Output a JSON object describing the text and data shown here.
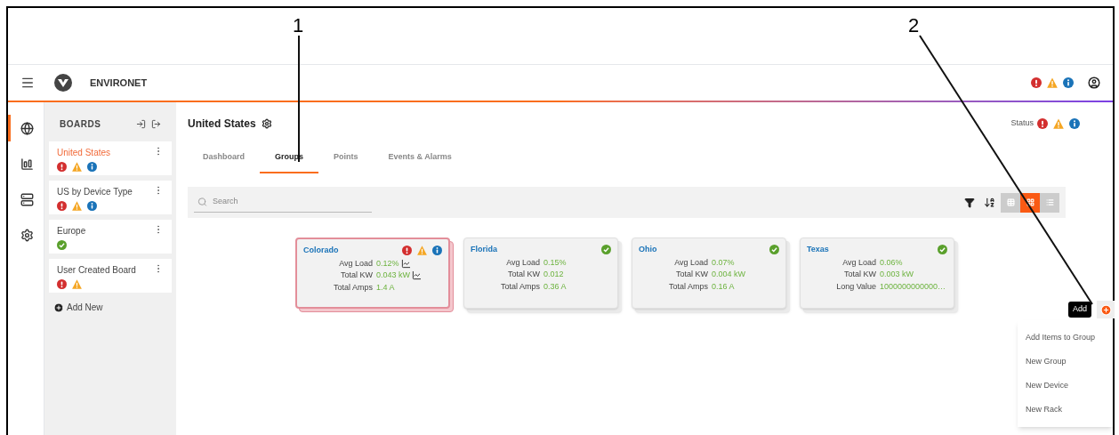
{
  "callouts": [
    {
      "number": "1"
    },
    {
      "number": "2"
    }
  ],
  "header": {
    "app_name": "ENVIRONET",
    "statuses": [
      {
        "kind": "critical"
      },
      {
        "kind": "warning"
      },
      {
        "kind": "info"
      }
    ]
  },
  "rail": [
    {
      "kind": "globe",
      "selected": true
    },
    {
      "kind": "chart",
      "selected": false
    },
    {
      "kind": "device",
      "selected": false
    },
    {
      "kind": "settings",
      "selected": false
    }
  ],
  "boards": {
    "title": "BOARDS",
    "items": [
      {
        "name": "United States",
        "selected": true,
        "statuses": [
          {
            "kind": "critical"
          },
          {
            "kind": "warning"
          },
          {
            "kind": "info"
          }
        ]
      },
      {
        "name": "US by Device Type",
        "selected": false,
        "statuses": [
          {
            "kind": "critical"
          },
          {
            "kind": "warning"
          },
          {
            "kind": "info"
          }
        ]
      },
      {
        "name": "Europe",
        "selected": false,
        "statuses": [
          {
            "kind": "ok"
          }
        ]
      },
      {
        "name": "User Created Board",
        "selected": false,
        "statuses": [
          {
            "kind": "critical"
          },
          {
            "kind": "warning"
          }
        ]
      }
    ],
    "add_new": "Add New"
  },
  "page": {
    "title": "United States",
    "status_label": "Status",
    "statuses": [
      {
        "kind": "critical"
      },
      {
        "kind": "warning"
      },
      {
        "kind": "info"
      }
    ]
  },
  "tabs": [
    {
      "label": "Dashboard",
      "selected": false
    },
    {
      "label": "Groups",
      "selected": true
    },
    {
      "label": "Points",
      "selected": false
    },
    {
      "label": "Events & Alarms",
      "selected": false
    }
  ],
  "toolbar": {
    "search_placeholder": "Search",
    "views": [
      {
        "kind": "table",
        "selected": false
      },
      {
        "kind": "grid",
        "selected": true
      },
      {
        "kind": "list",
        "selected": false
      }
    ]
  },
  "cards": [
    {
      "name": "Colorado",
      "selected": true,
      "statuses": [
        {
          "kind": "critical"
        },
        {
          "kind": "warning"
        },
        {
          "kind": "info"
        }
      ],
      "metrics": [
        {
          "label": "Avg Load",
          "value": "0.12%",
          "trend": true
        },
        {
          "label": "Total KW",
          "value": "0.043 kW",
          "trend": true
        },
        {
          "label": "Total Amps",
          "value": "1.4 A",
          "trend": false
        }
      ]
    },
    {
      "name": "Florida",
      "selected": false,
      "statuses": [
        {
          "kind": "ok"
        }
      ],
      "metrics": [
        {
          "label": "Avg Load",
          "value": "0.15%",
          "trend": false
        },
        {
          "label": "Total KW",
          "value": "0.012",
          "trend": false
        },
        {
          "label": "Total Amps",
          "value": "0.36 A",
          "trend": false
        }
      ]
    },
    {
      "name": "Ohio",
      "selected": false,
      "statuses": [
        {
          "kind": "ok"
        }
      ],
      "metrics": [
        {
          "label": "Avg Load",
          "value": "0.07%",
          "trend": false
        },
        {
          "label": "Total KW",
          "value": "0.004 kW",
          "trend": false
        },
        {
          "label": "Total Amps",
          "value": "0.16 A",
          "trend": false
        }
      ]
    },
    {
      "name": "Texas",
      "selected": false,
      "statuses": [
        {
          "kind": "ok"
        }
      ],
      "metrics": [
        {
          "label": "Avg Load",
          "value": "0.06%",
          "trend": false
        },
        {
          "label": "Total KW",
          "value": "0.003 kW",
          "trend": false
        },
        {
          "label": "Long Value",
          "value": "1000000000000…",
          "trend": false
        }
      ]
    }
  ],
  "add": {
    "tooltip": "Add",
    "menu": [
      "Add Items to Group",
      "New Group",
      "New Device",
      "New Rack"
    ]
  }
}
